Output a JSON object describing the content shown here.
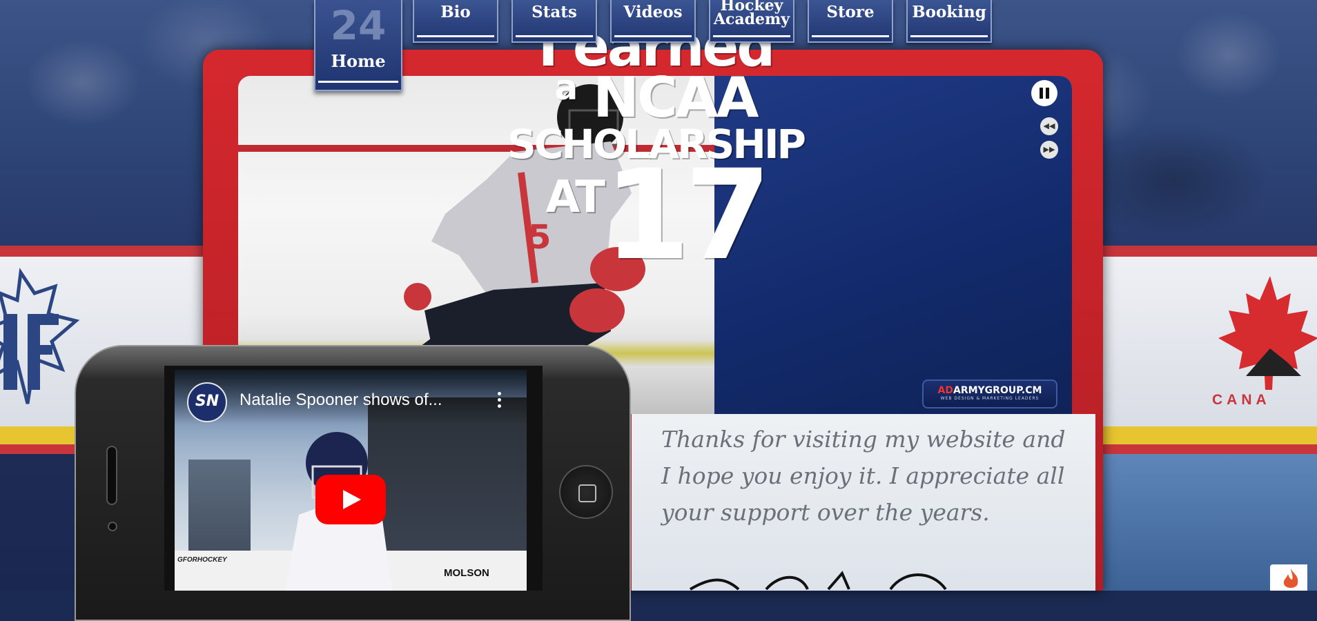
{
  "nav": {
    "home_number": "24",
    "home_label": "Home",
    "items": [
      {
        "label": "Bio"
      },
      {
        "label": "Stats"
      },
      {
        "label": "Videos"
      },
      {
        "label": "Hockey Academy"
      },
      {
        "label": "Store"
      },
      {
        "label": "Booking"
      }
    ]
  },
  "slider": {
    "headline": {
      "line1": "I earned",
      "line2_a": "a",
      "line2_b": "NCAA",
      "line3": "SCHOLARSHIP",
      "line4": "AT",
      "line5": "17"
    },
    "controls": {
      "pause": "pause-icon",
      "prev": "◀◀",
      "next": "▶▶"
    },
    "ad_badge": {
      "brand_red": "AD",
      "brand_white": "ARMYGROUP.C",
      "brand_end": "M",
      "tagline": "WEB DESIGN & MARKETING LEADERS"
    }
  },
  "video": {
    "channel_badge": "SN",
    "title": "Natalie Spooner shows of...",
    "board_ad": "GFORHOCKEY",
    "board_sponsor": "MOLSON"
  },
  "welcome": {
    "text": "Thanks for visiting my website and I hope you enjoy it. I appreciate all your support over the years."
  },
  "logos": {
    "canada_text": "CANA"
  },
  "colors": {
    "accent_red": "#c8363c",
    "navy": "#1f3470",
    "yellow_band": "#e7c530",
    "youtube_red": "#ff0000"
  }
}
